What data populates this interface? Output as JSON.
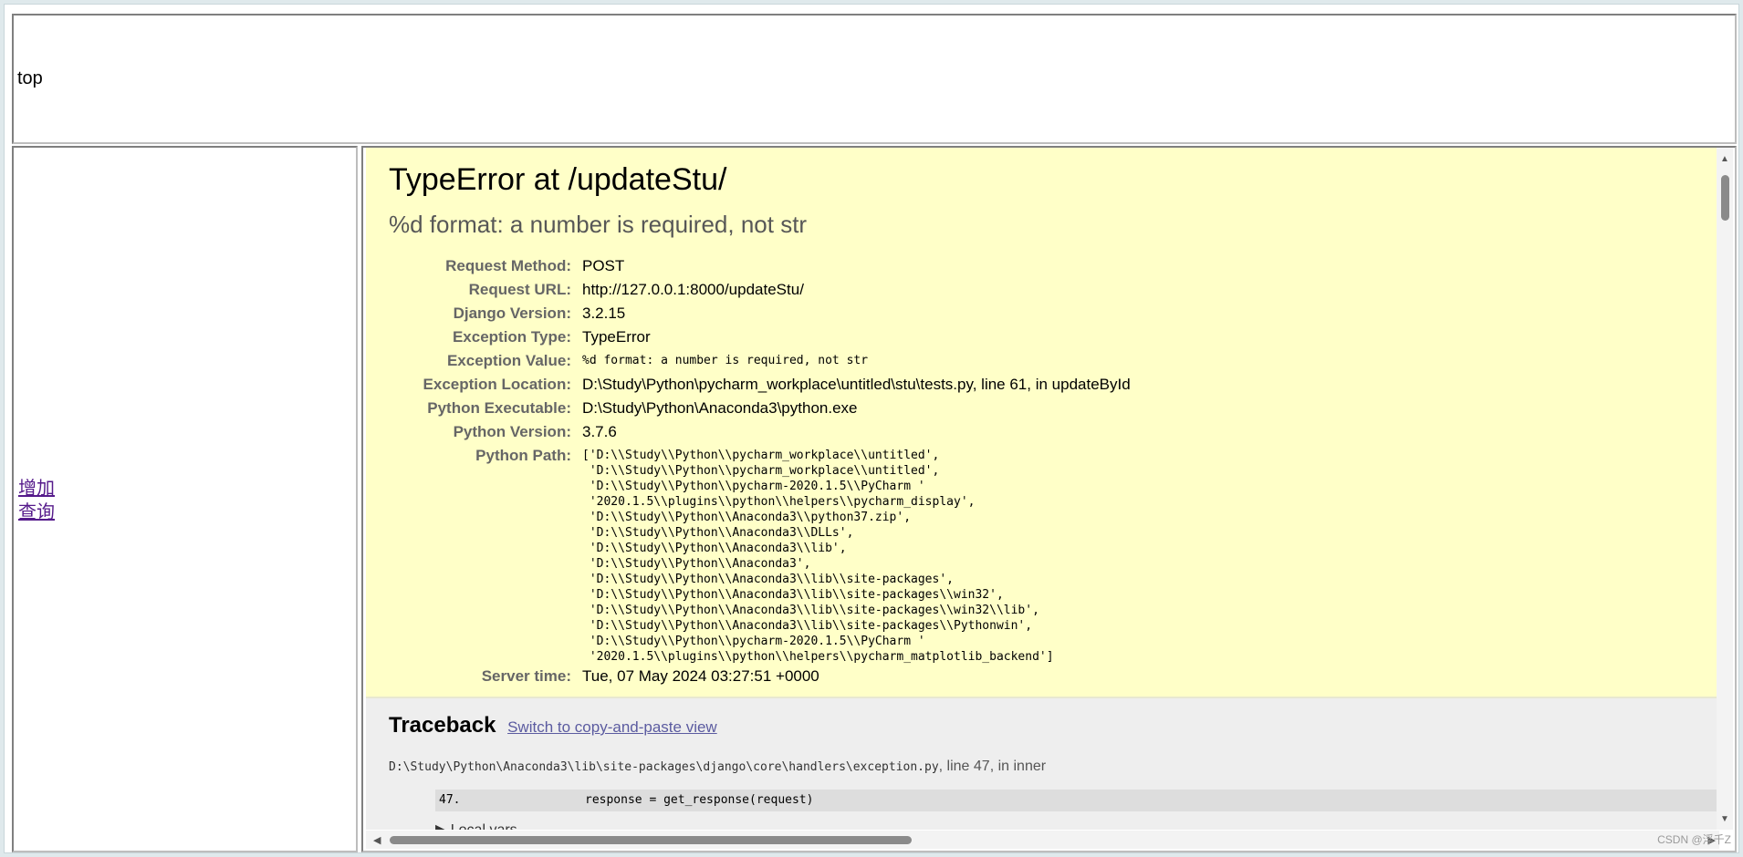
{
  "top": {
    "label": "top"
  },
  "nav": {
    "add": "增加",
    "query": "查询"
  },
  "error": {
    "title": "TypeError at /updateStu/",
    "subtitle": "%d format: a number is required, not str"
  },
  "meta": {
    "request_method_label": "Request Method:",
    "request_method": "POST",
    "request_url_label": "Request URL:",
    "request_url": "http://127.0.0.1:8000/updateStu/",
    "django_version_label": "Django Version:",
    "django_version": "3.2.15",
    "exception_type_label": "Exception Type:",
    "exception_type": "TypeError",
    "exception_value_label": "Exception Value:",
    "exception_value": "%d format: a number is required, not str",
    "exception_location_label": "Exception Location:",
    "exception_location": "D:\\Study\\Python\\pycharm_workplace\\untitled\\stu\\tests.py, line 61, in updateById",
    "python_executable_label": "Python Executable:",
    "python_executable": "D:\\Study\\Python\\Anaconda3\\python.exe",
    "python_version_label": "Python Version:",
    "python_version": "3.7.6",
    "python_path_label": "Python Path:",
    "python_path": "['D:\\\\Study\\\\Python\\\\pycharm_workplace\\\\untitled',\n 'D:\\\\Study\\\\Python\\\\pycharm_workplace\\\\untitled',\n 'D:\\\\Study\\\\Python\\\\pycharm-2020.1.5\\\\PyCharm '\n '2020.1.5\\\\plugins\\\\python\\\\helpers\\\\pycharm_display',\n 'D:\\\\Study\\\\Python\\\\Anaconda3\\\\python37.zip',\n 'D:\\\\Study\\\\Python\\\\Anaconda3\\\\DLLs',\n 'D:\\\\Study\\\\Python\\\\Anaconda3\\\\lib',\n 'D:\\\\Study\\\\Python\\\\Anaconda3',\n 'D:\\\\Study\\\\Python\\\\Anaconda3\\\\lib\\\\site-packages',\n 'D:\\\\Study\\\\Python\\\\Anaconda3\\\\lib\\\\site-packages\\\\win32',\n 'D:\\\\Study\\\\Python\\\\Anaconda3\\\\lib\\\\site-packages\\\\win32\\\\lib',\n 'D:\\\\Study\\\\Python\\\\Anaconda3\\\\lib\\\\site-packages\\\\Pythonwin',\n 'D:\\\\Study\\\\Python\\\\pycharm-2020.1.5\\\\PyCharm '\n '2020.1.5\\\\plugins\\\\python\\\\helpers\\\\pycharm_matplotlib_backend']",
    "server_time_label": "Server time:",
    "server_time": "Tue, 07 May 2024 03:27:51 +0000"
  },
  "traceback": {
    "title": "Traceback",
    "switch_link": "Switch to copy-and-paste view",
    "frame_path": "D:\\Study\\Python\\Anaconda3\\lib\\site-packages\\django\\core\\handlers\\exception.py",
    "frame_location": ", line 47, in inner",
    "code_line_number": "47.",
    "code_line": "response = get_response(request)",
    "code_more": "…",
    "local_vars": "▶ Local vars"
  },
  "icons": {
    "scroll_up": "scroll-up-icon",
    "scroll_down": "scroll-down-icon",
    "scroll_left": "scroll-left-icon",
    "scroll_right": "scroll-right-icon"
  },
  "watermark": "CSDN @浮千Z"
}
